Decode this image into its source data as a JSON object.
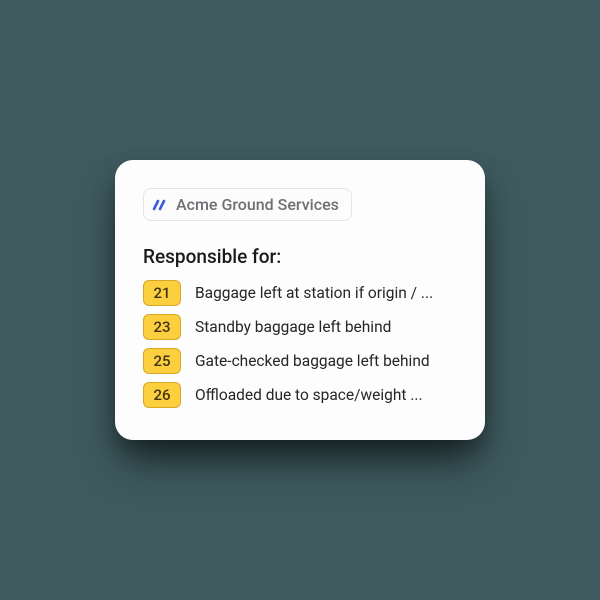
{
  "company": {
    "name": "Acme Ground Services"
  },
  "section": {
    "heading": "Responsible for:"
  },
  "items": [
    {
      "code": "21",
      "label": "Baggage left at station if origin / ..."
    },
    {
      "code": "23",
      "label": "Standby baggage left behind"
    },
    {
      "code": "25",
      "label": "Gate-checked baggage left behind"
    },
    {
      "code": "26",
      "label": "Offloaded due to space/weight ..."
    }
  ]
}
